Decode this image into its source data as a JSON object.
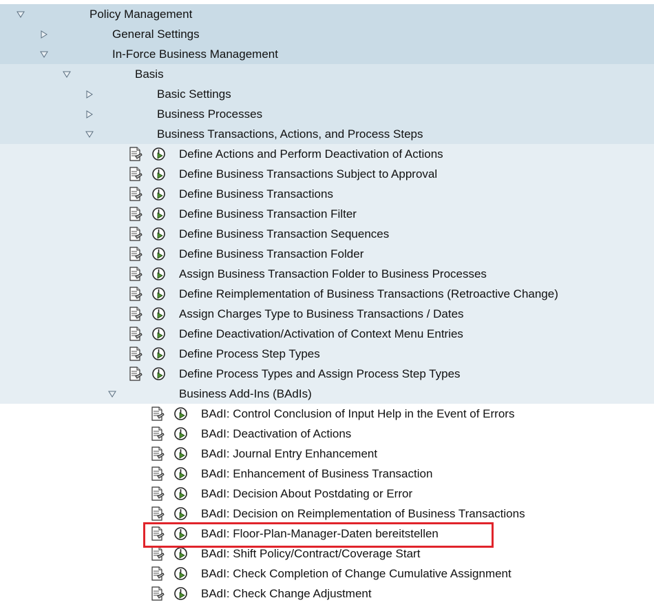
{
  "tree": [
    {
      "label": "Policy Management",
      "level": 0,
      "state": "expanded",
      "type": "folder",
      "band": "dark"
    },
    {
      "label": "General Settings",
      "level": 1,
      "state": "collapsed",
      "type": "folder",
      "band": "dark"
    },
    {
      "label": "In-Force Business Management",
      "level": 1,
      "state": "expanded",
      "type": "folder",
      "band": "dark"
    },
    {
      "label": "Basis",
      "level": 2,
      "state": "expanded",
      "type": "folder",
      "band": "mid"
    },
    {
      "label": "Basic Settings",
      "level": 3,
      "state": "collapsed",
      "type": "folder",
      "band": "mid"
    },
    {
      "label": "Business Processes",
      "level": 3,
      "state": "collapsed",
      "type": "folder",
      "band": "mid"
    },
    {
      "label": "Business Transactions, Actions, and Process Steps",
      "level": 3,
      "state": "expanded",
      "type": "folder",
      "band": "mid"
    },
    {
      "label": "Define Actions and Perform Deactivation of Actions",
      "level": 4,
      "type": "activity",
      "band": "light"
    },
    {
      "label": "Define Business Transactions Subject to Approval",
      "level": 4,
      "type": "activity",
      "band": "light"
    },
    {
      "label": "Define Business Transactions",
      "level": 4,
      "type": "activity",
      "band": "light"
    },
    {
      "label": "Define Business Transaction Filter",
      "level": 4,
      "type": "activity",
      "band": "light"
    },
    {
      "label": "Define Business Transaction Sequences",
      "level": 4,
      "type": "activity",
      "band": "light"
    },
    {
      "label": "Define Business Transaction Folder",
      "level": 4,
      "type": "activity",
      "band": "light"
    },
    {
      "label": "Assign Business Transaction Folder to Business Processes",
      "level": 4,
      "type": "activity",
      "band": "light"
    },
    {
      "label": "Define Reimplementation of Business Transactions (Retroactive Change)",
      "level": 4,
      "type": "activity",
      "band": "light"
    },
    {
      "label": "Assign Charges Type to Business Transactions / Dates",
      "level": 4,
      "type": "activity",
      "band": "light"
    },
    {
      "label": "Define Deactivation/Activation of Context Menu Entries",
      "level": 4,
      "type": "activity",
      "band": "light"
    },
    {
      "label": "Define Process Step Types",
      "level": 4,
      "type": "activity",
      "band": "light"
    },
    {
      "label": "Define Process Types and Assign Process Step Types",
      "level": 4,
      "type": "activity",
      "band": "light"
    },
    {
      "label": "Business Add-Ins (BAdIs)",
      "level": 4,
      "state": "expanded",
      "type": "folder",
      "band": "light"
    },
    {
      "label": "BAdI: Control Conclusion of Input Help in the Event of Errors",
      "level": 5,
      "type": "activity",
      "band": "white"
    },
    {
      "label": "BAdI: Deactivation of Actions",
      "level": 5,
      "type": "activity",
      "band": "white"
    },
    {
      "label": "BAdI: Journal Entry Enhancement",
      "level": 5,
      "type": "activity",
      "band": "white"
    },
    {
      "label": "BAdI: Enhancement of Business Transaction",
      "level": 5,
      "type": "activity",
      "band": "white"
    },
    {
      "label": "BAdI: Decision About Postdating or Error",
      "level": 5,
      "type": "activity",
      "band": "white"
    },
    {
      "label": "BAdI: Decision on Reimplementation of Business Transactions",
      "level": 5,
      "type": "activity",
      "band": "white"
    },
    {
      "label": "BAdI: Floor-Plan-Manager-Daten bereitstellen",
      "level": 5,
      "type": "activity",
      "band": "white",
      "highlighted": true
    },
    {
      "label": "BAdI: Shift Policy/Contract/Coverage Start",
      "level": 5,
      "type": "activity",
      "band": "white"
    },
    {
      "label": "BAdI: Check Completion of Change Cumulative Assignment",
      "level": 5,
      "type": "activity",
      "band": "white"
    },
    {
      "label": "BAdI: Check Change Adjustment",
      "level": 5,
      "type": "activity",
      "band": "white"
    }
  ],
  "colors": {
    "band_dark": "#c9dbe6",
    "band_mid": "#d8e5ed",
    "band_light": "#e6eef3",
    "highlight": "#e0242b",
    "clock_green": "#4f8f2f"
  },
  "icons": {
    "expanded": "triangle-down-icon",
    "collapsed": "triangle-right-icon",
    "document": "document-icon",
    "activity": "clock-execute-icon"
  }
}
